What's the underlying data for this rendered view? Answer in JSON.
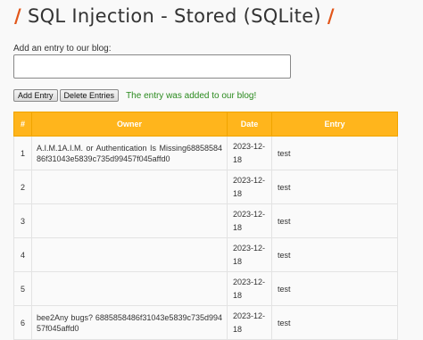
{
  "page": {
    "title": "SQL Injection - Stored (SQLite)",
    "title_slash": "/"
  },
  "form": {
    "label": "Add an entry to our blog:",
    "textarea_value": "",
    "add_button": "Add Entry",
    "delete_button": "Delete Entries",
    "status_message": "The entry was added to our blog!"
  },
  "table": {
    "headers": [
      "#",
      "Owner",
      "Date",
      "Entry"
    ],
    "rows": [
      {
        "num": "1",
        "owner": "A.I.M.1A.I.M. or Authentication Is Missing6885858486f31043e5839c735d99457f045affd0",
        "date": "2023-12-18",
        "entry": "test"
      },
      {
        "num": "2",
        "owner": "",
        "date": "2023-12-18",
        "entry": "test"
      },
      {
        "num": "3",
        "owner": "",
        "date": "2023-12-18",
        "entry": "test"
      },
      {
        "num": "4",
        "owner": "",
        "date": "2023-12-18",
        "entry": "test"
      },
      {
        "num": "5",
        "owner": "",
        "date": "2023-12-18",
        "entry": "test"
      },
      {
        "num": "6",
        "owner": "bee2Any bugs? 6885858486f31043e5839c735d99457f045affd0",
        "date": "2023-12-18",
        "entry": "test"
      }
    ]
  },
  "colors": {
    "accent": "#e2561a",
    "table_header": "#ffb51c",
    "success": "#2a8a1e"
  }
}
